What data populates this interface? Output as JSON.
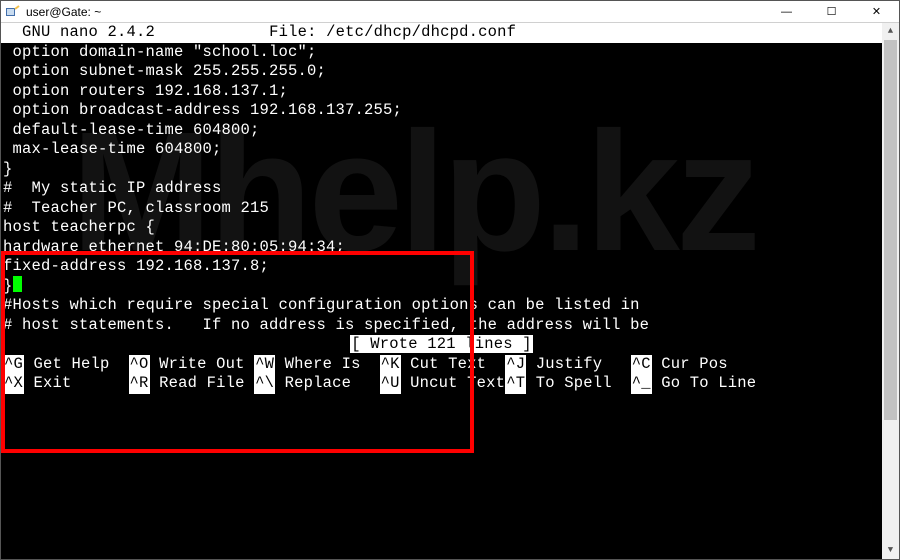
{
  "window": {
    "title": "user@Gate: ~"
  },
  "editor": {
    "app": "GNU nano",
    "version": "2.4.2",
    "file_label": "File:",
    "file_path": "/etc/dhcp/dhcpd.conf"
  },
  "content": {
    "l1": "",
    "l2": " option domain-name \"school.loc\";",
    "l3": " option subnet-mask 255.255.255.0;",
    "l4": " option routers 192.168.137.1;",
    "l5": " option broadcast-address 192.168.137.255;",
    "l6": " default-lease-time 604800;",
    "l7": " max-lease-time 604800;",
    "l8": "}",
    "l9": "",
    "l10": "",
    "l11": "#  My static IP address",
    "l12": "",
    "l13": "#  Teacher PC, classroom 215",
    "l14": "host teacherpc {",
    "l15": "hardware ethernet 94:DE:80:05:94:34;",
    "l16": "fixed-address 192.168.137.8;",
    "l17": "}",
    "l18": "",
    "l19": "",
    "l20": "",
    "l21": "#Hosts which require special configuration options can be listed in",
    "l22": "# host statements.   If no address is specified, the address will be"
  },
  "status": "[ Wrote 121 lines ]",
  "shortcuts": {
    "r1": {
      "k1": "^G",
      "t1": " Get Help  ",
      "k2": "^O",
      "t2": " Write Out ",
      "k3": "^W",
      "t3": " Where Is  ",
      "k4": "^K",
      "t4": " Cut Text  ",
      "k5": "^J",
      "t5": " Justify   ",
      "k6": "^C",
      "t6": " Cur Pos"
    },
    "r2": {
      "k1": "^X",
      "t1": " Exit      ",
      "k2": "^R",
      "t2": " Read File ",
      "k3": "^\\",
      "t3": " Replace   ",
      "k4": "^U",
      "t4": " Uncut Text",
      "k5": "^T",
      "t5": " To Spell  ",
      "k6": "^_",
      "t6": " Go To Line"
    }
  },
  "watermark": "Mhelp.kz"
}
